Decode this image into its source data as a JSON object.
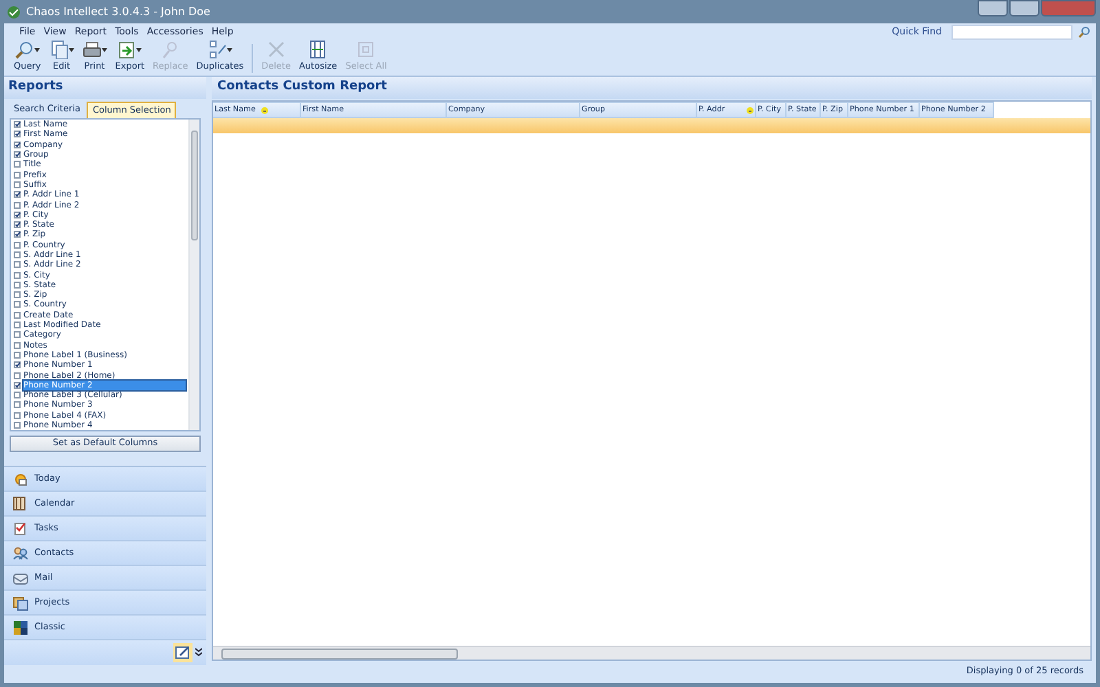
{
  "window": {
    "title": "Chaos Intellect 3.0.4.3 - John Doe"
  },
  "menu": [
    "File",
    "View",
    "Report",
    "Tools",
    "Accessories",
    "Help"
  ],
  "quick_find": {
    "label": "Quick Find"
  },
  "toolbar": [
    {
      "label": "Query",
      "disabled": false,
      "dropdown": true
    },
    {
      "label": "Edit",
      "disabled": false,
      "dropdown": true
    },
    {
      "label": "Print",
      "disabled": false,
      "dropdown": true
    },
    {
      "label": "Export",
      "disabled": false,
      "dropdown": true
    },
    {
      "label": "Replace",
      "disabled": true,
      "dropdown": false
    },
    {
      "label": "Duplicates",
      "disabled": false,
      "dropdown": true
    },
    {
      "label": "Delete",
      "disabled": true,
      "dropdown": false
    },
    {
      "label": "Autosize",
      "disabled": false,
      "dropdown": false
    },
    {
      "label": "Select All",
      "disabled": true,
      "dropdown": false
    }
  ],
  "sidebar": {
    "title": "Reports",
    "tabs": [
      {
        "label": "Search Criteria",
        "selected": false
      },
      {
        "label": "Column Selection",
        "selected": true
      }
    ],
    "columns": [
      {
        "label": "Last Name",
        "checked": true,
        "selected": false
      },
      {
        "label": "First Name",
        "checked": true,
        "selected": false
      },
      {
        "label": "Company",
        "checked": true,
        "selected": false
      },
      {
        "label": "Group",
        "checked": true,
        "selected": false
      },
      {
        "label": "Title",
        "checked": false,
        "selected": false
      },
      {
        "label": "Prefix",
        "checked": false,
        "selected": false
      },
      {
        "label": "Suffix",
        "checked": false,
        "selected": false
      },
      {
        "label": "P. Addr Line 1",
        "checked": true,
        "selected": false
      },
      {
        "label": "P. Addr Line 2",
        "checked": false,
        "selected": false
      },
      {
        "label": "P. City",
        "checked": true,
        "selected": false
      },
      {
        "label": "P. State",
        "checked": true,
        "selected": false
      },
      {
        "label": "P. Zip",
        "checked": true,
        "selected": false
      },
      {
        "label": "P. Country",
        "checked": false,
        "selected": false
      },
      {
        "label": "S. Addr Line 1",
        "checked": false,
        "selected": false
      },
      {
        "label": "S. Addr Line 2",
        "checked": false,
        "selected": false
      },
      {
        "label": "S. City",
        "checked": false,
        "selected": false
      },
      {
        "label": "S. State",
        "checked": false,
        "selected": false
      },
      {
        "label": "S. Zip",
        "checked": false,
        "selected": false
      },
      {
        "label": "S. Country",
        "checked": false,
        "selected": false
      },
      {
        "label": "Create Date",
        "checked": false,
        "selected": false
      },
      {
        "label": "Last Modified Date",
        "checked": false,
        "selected": false
      },
      {
        "label": "Category",
        "checked": false,
        "selected": false
      },
      {
        "label": "Notes",
        "checked": false,
        "selected": false
      },
      {
        "label": "Phone Label 1 (Business)",
        "checked": false,
        "selected": false
      },
      {
        "label": "Phone Number 1",
        "checked": true,
        "selected": false
      },
      {
        "label": "Phone Label 2 (Home)",
        "checked": false,
        "selected": false
      },
      {
        "label": "Phone Number 2",
        "checked": true,
        "selected": true
      },
      {
        "label": "Phone Label 3 (Cellular)",
        "checked": false,
        "selected": false
      },
      {
        "label": "Phone Number 3",
        "checked": false,
        "selected": false
      },
      {
        "label": "Phone Label 4 (FAX)",
        "checked": false,
        "selected": false
      },
      {
        "label": "Phone Number 4",
        "checked": false,
        "selected": false
      }
    ],
    "default_button": "Set as Default Columns"
  },
  "nav": [
    {
      "label": "Today"
    },
    {
      "label": "Calendar"
    },
    {
      "label": "Tasks"
    },
    {
      "label": "Contacts"
    },
    {
      "label": "Mail"
    },
    {
      "label": "Projects"
    },
    {
      "label": "Classic"
    }
  ],
  "report": {
    "title": "Contacts Custom Report",
    "columns": [
      {
        "label": "Last Name",
        "sorted": true
      },
      {
        "label": "First Name",
        "sorted": false
      },
      {
        "label": "Company",
        "sorted": false
      },
      {
        "label": "Group",
        "sorted": false
      },
      {
        "label": "P. Addr",
        "sorted": true
      },
      {
        "label": "P. City",
        "sorted": false
      },
      {
        "label": "P. State",
        "sorted": false
      },
      {
        "label": "P. Zip",
        "sorted": false
      },
      {
        "label": "Phone Number 1",
        "sorted": false
      },
      {
        "label": "Phone Number 2",
        "sorted": false
      }
    ]
  },
  "status_bar": "Displaying 0 of 25 records"
}
